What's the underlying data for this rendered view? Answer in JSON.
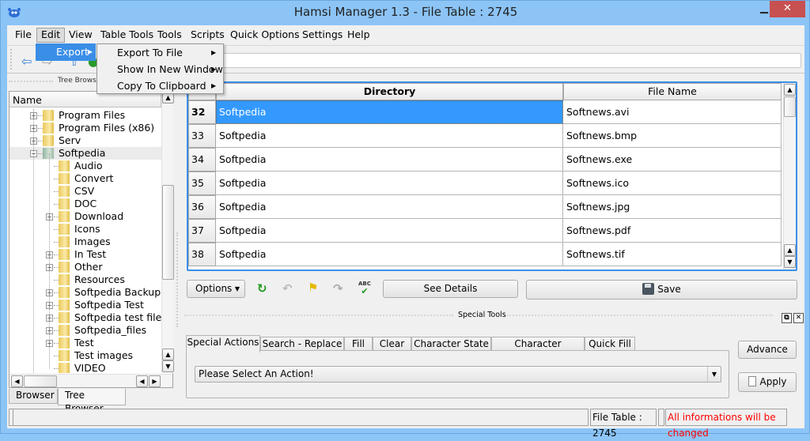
{
  "window": {
    "title": "Hamsi Manager 1.3 - File Table : 2745",
    "minimize_glyph": "▁",
    "maximize_glyph": "☐",
    "close_glyph": "✕"
  },
  "menubar": [
    "File",
    "Edit",
    "View",
    "Table Tools",
    "Tools",
    "Scripts",
    "Quick Options",
    "Settings",
    "Help"
  ],
  "edit_menu": {
    "items": [
      {
        "label": "Export",
        "has_submenu": true
      }
    ]
  },
  "export_submenu": {
    "items": [
      {
        "label": "Export To File",
        "has_submenu": true
      },
      {
        "label": "Show In New Window",
        "has_submenu": true
      },
      {
        "label": "Copy To Clipboard",
        "has_submenu": true
      }
    ]
  },
  "toolbar": {
    "icons": [
      "back-arrow-icon",
      "forward-arrow-icon",
      "up-icon",
      "refresh-icon"
    ],
    "address_value": ""
  },
  "left_panel": {
    "dock_title": "Tree Browser",
    "tree_header": "Name",
    "tree": [
      {
        "label": "Program Files",
        "level": 1,
        "expandable": true,
        "expanded": false
      },
      {
        "label": "Program Files (x86)",
        "level": 1,
        "expandable": true,
        "expanded": false
      },
      {
        "label": "Serv",
        "level": 1,
        "expandable": true,
        "expanded": false
      },
      {
        "label": "Softpedia",
        "level": 1,
        "expandable": true,
        "expanded": true,
        "selected": true
      },
      {
        "label": "Audio",
        "level": 2,
        "expandable": false
      },
      {
        "label": "Convert",
        "level": 2,
        "expandable": false
      },
      {
        "label": "CSV",
        "level": 2,
        "expandable": false
      },
      {
        "label": "DOC",
        "level": 2,
        "expandable": false
      },
      {
        "label": "Download",
        "level": 2,
        "expandable": true
      },
      {
        "label": "Icons",
        "level": 2,
        "expandable": false
      },
      {
        "label": "Images",
        "level": 2,
        "expandable": false
      },
      {
        "label": "In Test",
        "level": 2,
        "expandable": true
      },
      {
        "label": "Other",
        "level": 2,
        "expandable": true
      },
      {
        "label": "Resources",
        "level": 2,
        "expandable": false
      },
      {
        "label": "Softpedia Backup",
        "level": 2,
        "expandable": true
      },
      {
        "label": "Softpedia Test",
        "level": 2,
        "expandable": true
      },
      {
        "label": "Softpedia test files",
        "level": 2,
        "expandable": true
      },
      {
        "label": "Softpedia_files",
        "level": 2,
        "expandable": true
      },
      {
        "label": "Test",
        "level": 2,
        "expandable": true
      },
      {
        "label": "Test images",
        "level": 2,
        "expandable": false
      },
      {
        "label": "VIDEO",
        "level": 2,
        "expandable": false
      }
    ],
    "tabs": [
      {
        "label": "Browser",
        "active": false
      },
      {
        "label": "Tree Browser",
        "active": true
      }
    ]
  },
  "table": {
    "columns": [
      "Directory",
      "File Name"
    ],
    "rows": [
      {
        "num": "32",
        "directory": "Softpedia",
        "file": "Softnews.avi",
        "selected": true
      },
      {
        "num": "33",
        "directory": "Softpedia",
        "file": "Softnews.bmp"
      },
      {
        "num": "34",
        "directory": "Softpedia",
        "file": "Softnews.exe"
      },
      {
        "num": "35",
        "directory": "Softpedia",
        "file": "Softnews.ico"
      },
      {
        "num": "36",
        "directory": "Softpedia",
        "file": "Softnews.jpg"
      },
      {
        "num": "37",
        "directory": "Softpedia",
        "file": "Softnews.pdf"
      },
      {
        "num": "38",
        "directory": "Softpedia",
        "file": "Softnews.tif"
      }
    ]
  },
  "actions": {
    "options_label": "Options",
    "see_details_label": "See Details",
    "save_label": "Save"
  },
  "special_tools": {
    "title": "Special Tools",
    "tabs": [
      {
        "label": "Special Actions",
        "active": true
      },
      {
        "label": "Search - Replace"
      },
      {
        "label": "Fill"
      },
      {
        "label": "Clear"
      },
      {
        "label": "Character State"
      },
      {
        "label": "Character Encoding"
      },
      {
        "label": "Quick Fill"
      }
    ],
    "action_select_value": "Please Select An Action!",
    "advance_label": "Advance",
    "apply_label": "Apply"
  },
  "status": {
    "file_table_count": "File Table : 2745",
    "warning": "All informations will be changed",
    "warning_color": "#ff0000"
  },
  "colors": {
    "selection": "#3399ff",
    "titlebar": "#8cc4f6",
    "close_button": "#c75050"
  }
}
